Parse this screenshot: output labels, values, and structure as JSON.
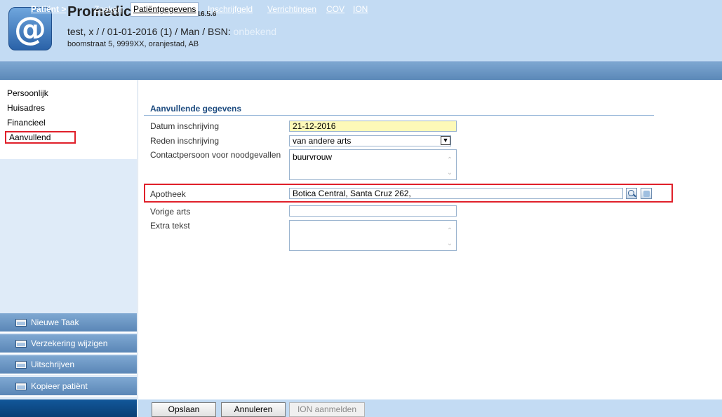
{
  "header": {
    "app_title": "Promedico-ASP",
    "version": "v. 2016.5.6",
    "patient_line": "test, x / / 01-01-2016 (1) / Man / BSN: ",
    "bsn_value": "onbekend",
    "address": "boomstraat 5, 9999XX, oranjestad, AB",
    "logo_glyph": "@"
  },
  "nav": {
    "patient": "Patiënt >",
    "items": [
      "Zoeken",
      "Patiëntgegevens",
      "Inschrijfgeld",
      "Verrichtingen",
      "COV",
      "ION"
    ],
    "active": "Patiëntgegevens"
  },
  "sidebar": {
    "items": [
      "Persoonlijk",
      "Huisadres",
      "Financieel",
      "Aanvullend"
    ],
    "active": "Aanvullend",
    "tasks": [
      "Nieuwe Taak",
      "Verzekering wijzigen",
      "Uitschrijven",
      "Kopieer patiënt"
    ]
  },
  "form": {
    "section_title": "Aanvullende gegevens",
    "datum_label": "Datum inschrijving",
    "datum_value": "21-12-2016",
    "reden_label": "Reden inschrijving",
    "reden_value": "van andere arts",
    "contact_label": "Contactpersoon voor noodgevallen",
    "contact_value": "buurvrouw",
    "apotheek_label": "Apotheek",
    "apotheek_value": "Botica Central, Santa Cruz 262,",
    "vorige_label": "Vorige arts",
    "vorige_value": "",
    "extra_label": "Extra tekst",
    "extra_value": ""
  },
  "footer": {
    "save": "Opslaan",
    "cancel": "Annuleren",
    "ion": "ION aanmelden"
  },
  "colors": {
    "header_bg": "#c3dbf3",
    "nav_bg": "#6b96c4",
    "highlight": "#e0202a",
    "date_field_bg": "#fdf9b8"
  }
}
